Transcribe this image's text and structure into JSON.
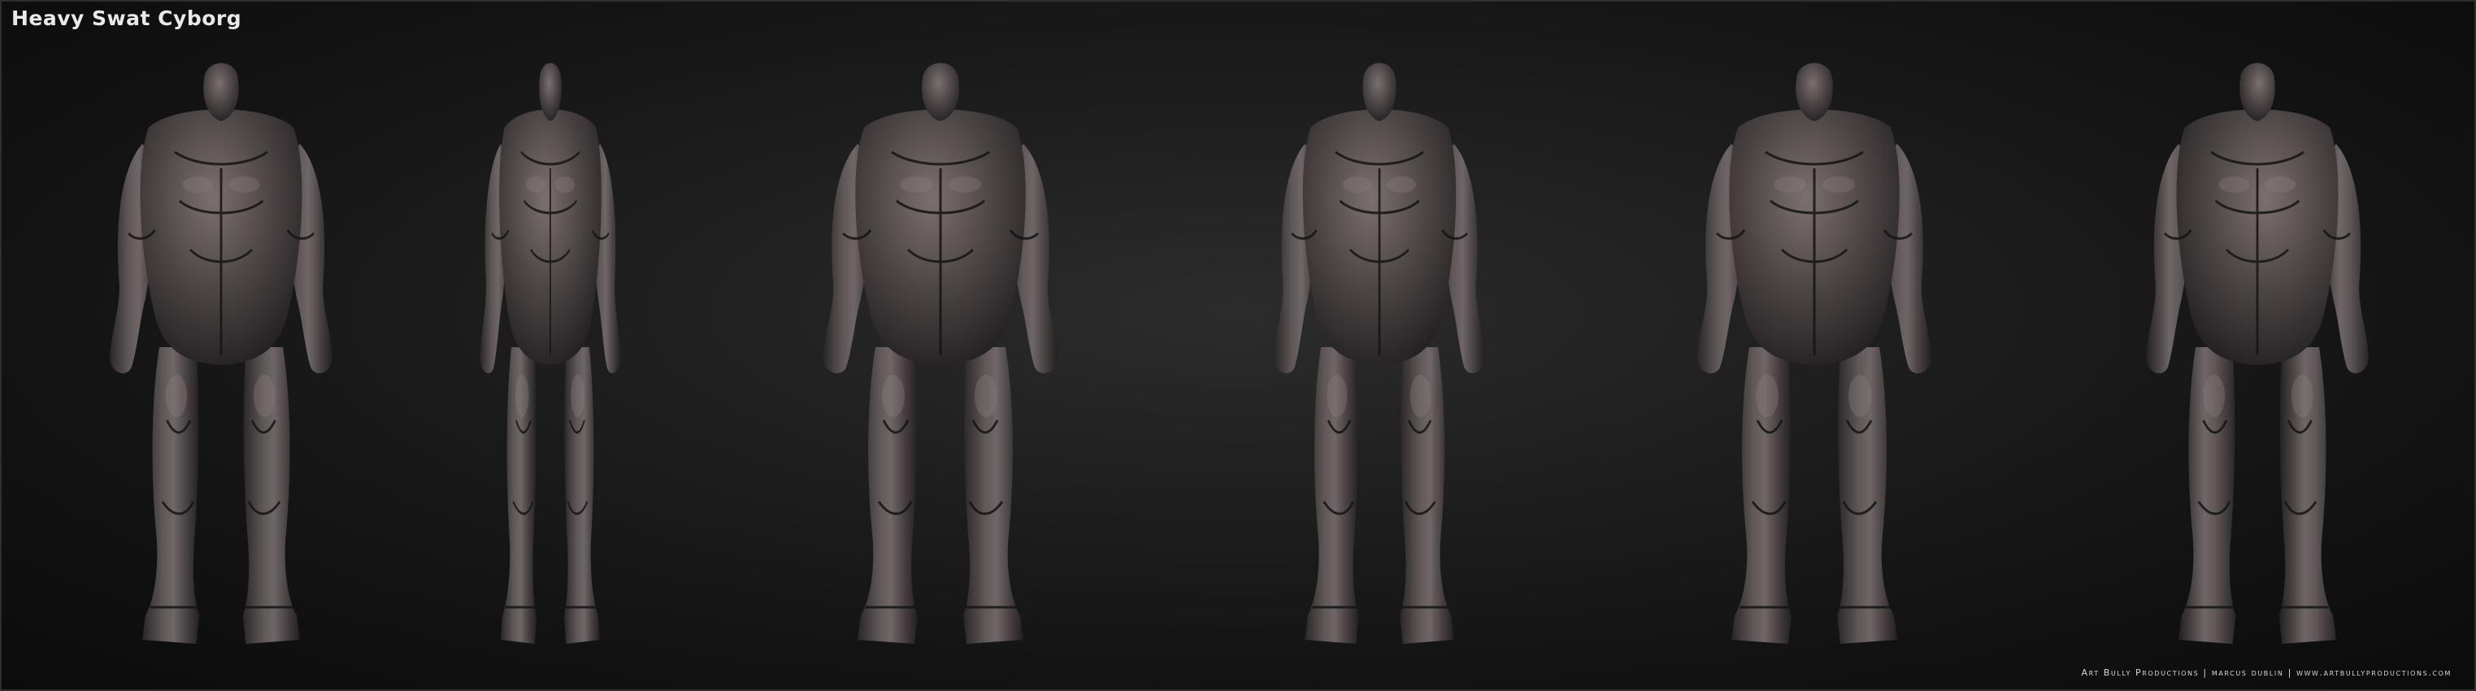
{
  "header": {
    "title": "Heavy Swat Cyborg"
  },
  "footer": {
    "credits": "Art Bully Productions | marcus dublin | www.artbullyproductions.com"
  },
  "figures": [
    {
      "view": "front-three-quarter"
    },
    {
      "view": "side"
    },
    {
      "view": "front"
    },
    {
      "view": "back-three-quarter"
    },
    {
      "view": "back"
    },
    {
      "view": "front-three-quarter-left"
    }
  ],
  "colors": {
    "background": "#1d1d1d",
    "body_base": "#3f3b3c",
    "body_highlight": "#7a7070",
    "panel_line": "#151313"
  }
}
